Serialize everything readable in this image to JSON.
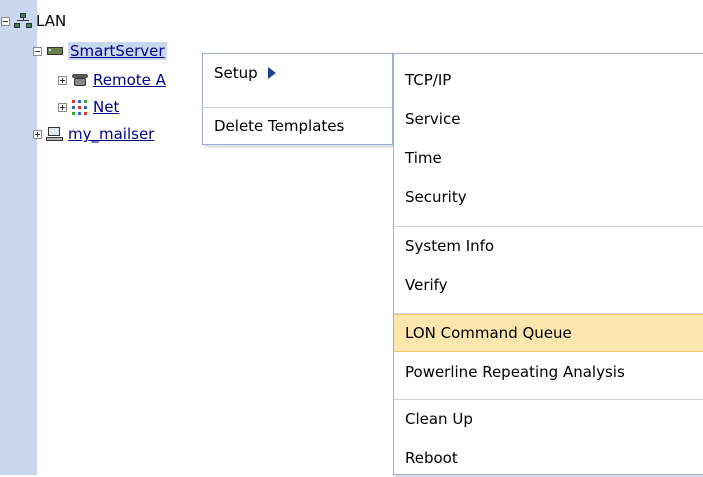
{
  "tree": {
    "root": {
      "label": "LAN"
    },
    "smartserver": {
      "label": "SmartServer"
    },
    "remote": {
      "label": "Remote A"
    },
    "net": {
      "label": "Net"
    },
    "mailserver": {
      "label": "my_mailser"
    }
  },
  "context_menu": {
    "setup_label": "Setup",
    "delete_templates_label": "Delete Templates"
  },
  "setup_submenu": {
    "items": [
      "TCP/IP",
      "Service",
      "Time",
      "Security",
      "System Info",
      "Verify",
      "LON Command Queue",
      "Powerline Repeating Analysis",
      "Clean Up",
      "Reboot"
    ],
    "highlighted": "LON Command Queue"
  },
  "colors": {
    "sidebar_strip": "#c9d7ef",
    "menu_border": "#9bb0d2",
    "highlight": "#fce6ad",
    "link": "#00008b"
  }
}
